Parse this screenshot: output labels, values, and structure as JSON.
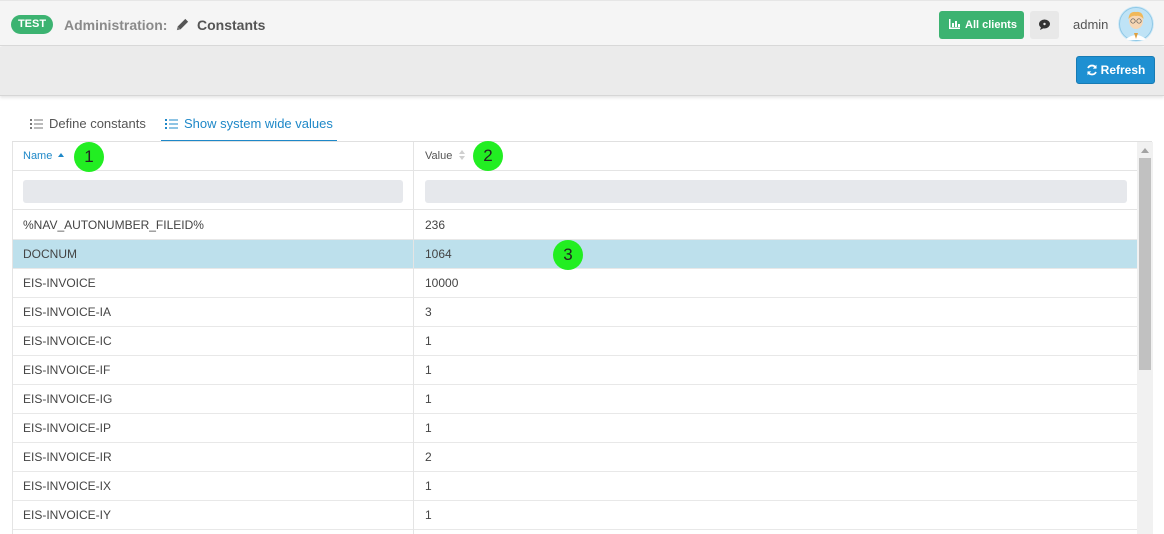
{
  "header": {
    "env_badge": "TEST",
    "breadcrumb_section": "Administration:",
    "breadcrumb_page": "Constants",
    "all_clients_label": "All clients",
    "username": "admin"
  },
  "toolbar": {
    "refresh_label": "Refresh"
  },
  "tabs": [
    {
      "label": "Define constants",
      "active": false
    },
    {
      "label": "Show system wide values",
      "active": true
    }
  ],
  "table": {
    "columns": [
      {
        "label": "Name",
        "sort": "ascending"
      },
      {
        "label": "Value",
        "sort": "none"
      }
    ],
    "rows": [
      {
        "name": "%NAV_AUTONUMBER_FILEID%",
        "value": "236",
        "selected": false
      },
      {
        "name": "DOCNUM",
        "value": "1064",
        "selected": true
      },
      {
        "name": "EIS-INVOICE",
        "value": "10000",
        "selected": false
      },
      {
        "name": "EIS-INVOICE-IA",
        "value": "3",
        "selected": false
      },
      {
        "name": "EIS-INVOICE-IC",
        "value": "1",
        "selected": false
      },
      {
        "name": "EIS-INVOICE-IF",
        "value": "1",
        "selected": false
      },
      {
        "name": "EIS-INVOICE-IG",
        "value": "1",
        "selected": false
      },
      {
        "name": "EIS-INVOICE-IP",
        "value": "1",
        "selected": false
      },
      {
        "name": "EIS-INVOICE-IR",
        "value": "2",
        "selected": false
      },
      {
        "name": "EIS-INVOICE-IX",
        "value": "1",
        "selected": false
      },
      {
        "name": "EIS-INVOICE-IY",
        "value": "1",
        "selected": false
      }
    ]
  },
  "markers": [
    "1",
    "2",
    "3"
  ],
  "colors": {
    "accent_green": "#3cb371",
    "accent_blue": "#1e88c8",
    "selected_row": "#bde0ec",
    "marker": "#22ee22"
  },
  "icons": [
    "pencil-icon",
    "chart-icon",
    "chat-icon",
    "refresh-icon",
    "list-icon",
    "sort-asc-icon",
    "sort-both-icon"
  ]
}
